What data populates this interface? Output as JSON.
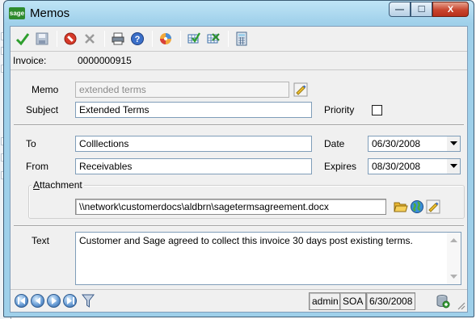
{
  "window": {
    "title": "Memos",
    "logo_text": "sage"
  },
  "caption_buttons": {
    "minimize": "—",
    "maximize": "☐",
    "close": "X"
  },
  "toolbar": {
    "icons": [
      "accept-icon",
      "save-icon",
      "delete-icon",
      "clear-icon",
      "print-icon",
      "help-icon",
      "color-wheel-icon",
      "grid-check-icon",
      "grid-cross-icon",
      "calculator-icon"
    ]
  },
  "invoice": {
    "label": "Invoice:",
    "value": "0000000915"
  },
  "memo": {
    "label": "Memo",
    "value": "extended terms"
  },
  "subject": {
    "label": "Subject",
    "value": "Extended Terms"
  },
  "priority": {
    "label": "Priority",
    "checked": false
  },
  "to": {
    "label": "To",
    "value": "Colllections"
  },
  "from": {
    "label": "From",
    "value": "Receivables"
  },
  "date": {
    "label": "Date",
    "value": "06/30/2008"
  },
  "expires": {
    "label": "Expires",
    "value": "08/30/2008"
  },
  "attachment": {
    "label_first": "A",
    "label_rest": "ttachment",
    "path": "\\\\network\\customerdocs\\aldbrn\\sagetermsagreement.docx"
  },
  "text": {
    "label": "Text",
    "value": "Customer and Sage agreed to collect this invoice 30 days post existing terms."
  },
  "status": {
    "user": "admin",
    "company": "SOA",
    "date": "6/30/2008"
  },
  "colors": {
    "title_bg": "#9fd0ea",
    "client_bg": "#f0f0f0",
    "field_border": "#7f9db9",
    "close_red": "#c8452e"
  }
}
